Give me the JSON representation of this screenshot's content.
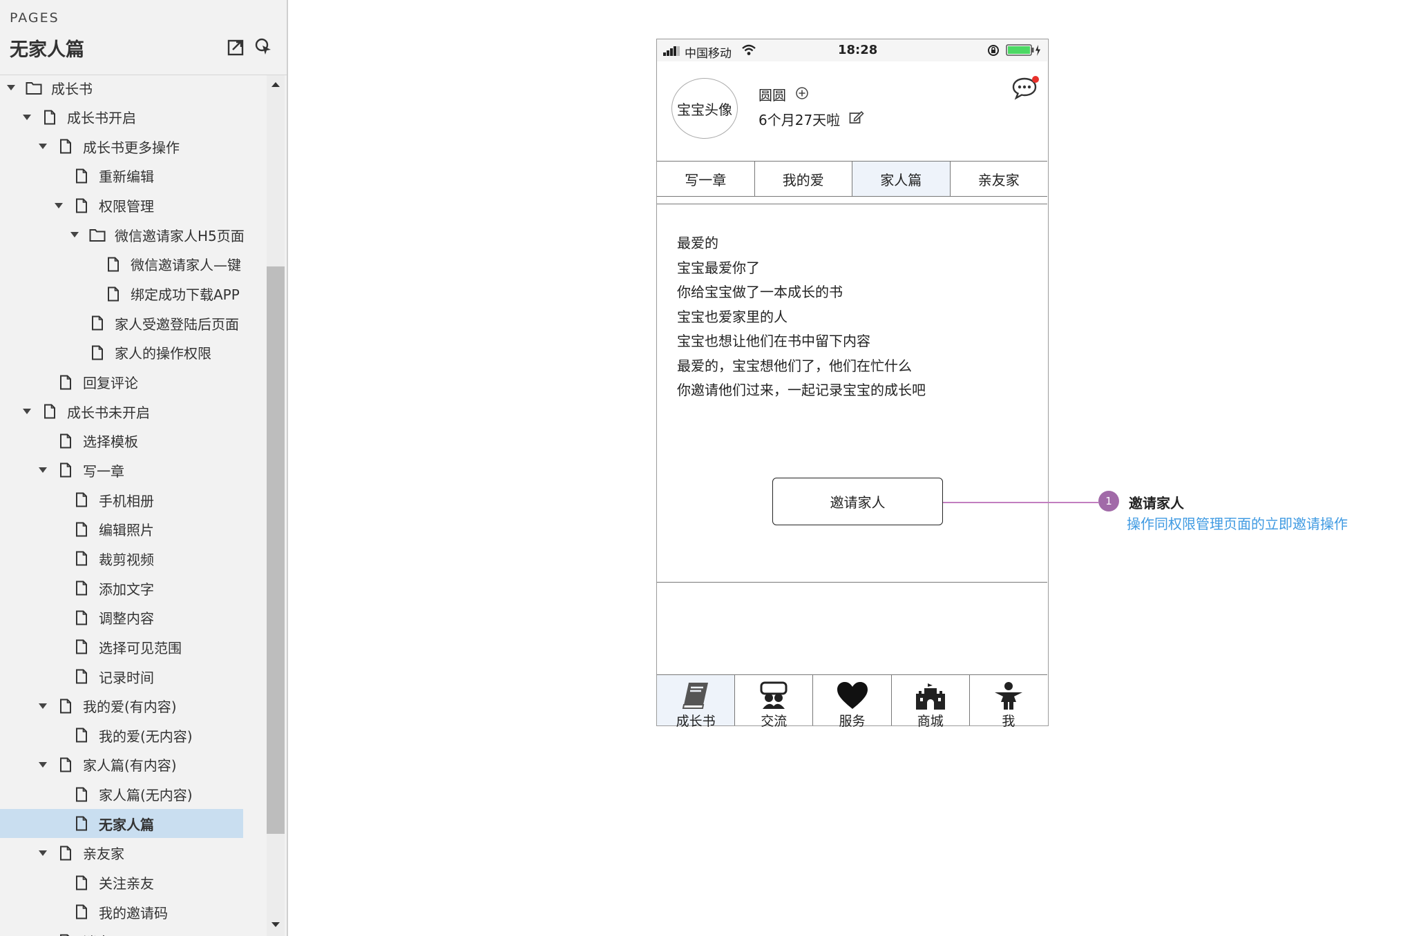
{
  "sidebar": {
    "pages_label": "PAGES",
    "title": "无家人篇",
    "tree": [
      {
        "label": "成长书",
        "icon": "folder-icon",
        "level": 0,
        "expanded": true
      },
      {
        "label": "成长书开启",
        "icon": "page-icon",
        "level": 1,
        "expanded": true
      },
      {
        "label": "成长书更多操作",
        "icon": "page-icon",
        "level": 2,
        "expanded": true
      },
      {
        "label": "重新编辑",
        "icon": "page-icon",
        "level": 3
      },
      {
        "label": "权限管理",
        "icon": "page-icon",
        "level": 3,
        "expanded": true
      },
      {
        "label": "微信邀请家人H5页面",
        "icon": "folder-icon",
        "level": 4,
        "expanded": true
      },
      {
        "label": "微信邀请家人—键",
        "icon": "page-icon",
        "level": 5
      },
      {
        "label": "绑定成功下载APP",
        "icon": "page-icon",
        "level": 5
      },
      {
        "label": "家人受邀登陆后页面",
        "icon": "page-icon",
        "level": 4
      },
      {
        "label": "家人的操作权限",
        "icon": "page-icon",
        "level": 4
      },
      {
        "label": "回复评论",
        "icon": "page-icon",
        "level": 2
      },
      {
        "label": "成长书未开启",
        "icon": "page-icon",
        "level": 1,
        "expanded": true
      },
      {
        "label": "选择模板",
        "icon": "page-icon",
        "level": 2
      },
      {
        "label": "写一章",
        "icon": "page-icon",
        "level": 2,
        "expanded": true
      },
      {
        "label": "手机相册",
        "icon": "page-icon",
        "level": 3
      },
      {
        "label": "编辑照片",
        "icon": "page-icon",
        "level": 3
      },
      {
        "label": "裁剪视频",
        "icon": "page-icon",
        "level": 3
      },
      {
        "label": "添加文字",
        "icon": "page-icon",
        "level": 3
      },
      {
        "label": "调整内容",
        "icon": "page-icon",
        "level": 3
      },
      {
        "label": "选择可见范围",
        "icon": "page-icon",
        "level": 3
      },
      {
        "label": "记录时间",
        "icon": "page-icon",
        "level": 3
      },
      {
        "label": "我的爱(有内容)",
        "icon": "page-icon",
        "level": 2,
        "expanded": true
      },
      {
        "label": "我的爱(无内容)",
        "icon": "page-icon",
        "level": 3
      },
      {
        "label": "家人篇(有内容)",
        "icon": "page-icon",
        "level": 2,
        "expanded": true
      },
      {
        "label": "家人篇(无内容)",
        "icon": "page-icon",
        "level": 3
      },
      {
        "label": "无家人篇",
        "icon": "page-icon",
        "level": 3,
        "selected": true
      },
      {
        "label": "亲友家",
        "icon": "page-icon",
        "level": 2,
        "expanded": true
      },
      {
        "label": "关注亲友",
        "icon": "page-icon",
        "level": 3
      },
      {
        "label": "我的邀请码",
        "icon": "page-icon",
        "level": 3
      },
      {
        "label": "消息",
        "icon": "page-icon",
        "level": 2
      }
    ]
  },
  "phone": {
    "status_bar": {
      "carrier": "中国移动",
      "time": "18:28",
      "battery_color": "#4cd964"
    },
    "profile": {
      "avatar_text": "宝宝头像",
      "name": "圆圆",
      "age": "6个月27天啦",
      "notification_dot_color": "#e8302a"
    },
    "tabs": [
      {
        "label": "写一章",
        "active": false
      },
      {
        "label": "我的爱",
        "active": false
      },
      {
        "label": "家人篇",
        "active": true
      },
      {
        "label": "亲友家",
        "active": false
      }
    ],
    "letter_lines": [
      "最爱的",
      "宝宝最爱你了",
      "你给宝宝做了一本成长的书",
      "宝宝也爱家里的人",
      "宝宝也想让他们在书中留下内容",
      "最爱的，宝宝想他们了，他们在忙什么",
      "你邀请他们过来，一起记录宝宝的成长吧"
    ],
    "invite_button": "邀请家人",
    "bottom_nav": [
      {
        "label": "成长书",
        "icon": "book-icon",
        "active": true
      },
      {
        "label": "交流",
        "icon": "community-icon",
        "active": false
      },
      {
        "label": "服务",
        "icon": "heart-icon",
        "active": false
      },
      {
        "label": "商城",
        "icon": "castle-icon",
        "active": false
      },
      {
        "label": "我",
        "icon": "person-icon",
        "active": false
      }
    ]
  },
  "annotation": {
    "marker": "1",
    "title": "邀请家人",
    "description": "操作同权限管理页面的立即邀请操作",
    "line_color": "#c27ec0",
    "marker_color": "#a16aa8",
    "description_color": "#3f9ae2"
  }
}
